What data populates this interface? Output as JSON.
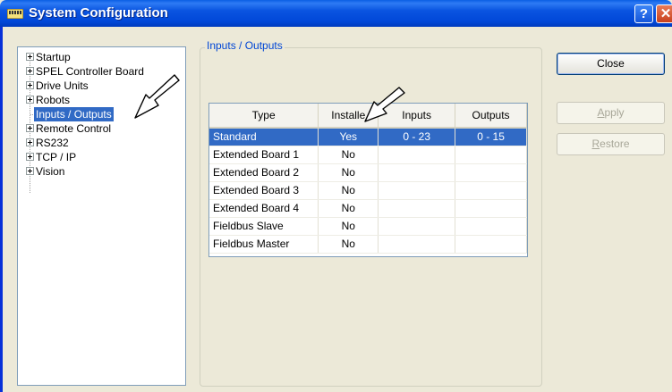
{
  "window": {
    "title": "System Configuration",
    "help_label": "?",
    "close_label": "✕"
  },
  "tree": {
    "items": [
      {
        "label": "Startup",
        "expandable": true
      },
      {
        "label": "SPEL Controller Board",
        "expandable": true
      },
      {
        "label": "Drive Units",
        "expandable": true
      },
      {
        "label": "Robots",
        "expandable": true
      },
      {
        "label": "Inputs / Outputs",
        "expandable": false,
        "selected": true
      },
      {
        "label": "Remote Control",
        "expandable": true
      },
      {
        "label": "RS232",
        "expandable": true
      },
      {
        "label": "TCP / IP",
        "expandable": true
      },
      {
        "label": "Vision",
        "expandable": true
      }
    ]
  },
  "group": {
    "title": "Inputs / Outputs"
  },
  "grid": {
    "columns": [
      "Type",
      "Installe",
      "Inputs",
      "Outputs"
    ],
    "rows": [
      {
        "type": "Standard",
        "installed": "Yes",
        "inputs": "0 - 23",
        "outputs": "0 - 15",
        "selected": true
      },
      {
        "type": "Extended Board 1",
        "installed": "No",
        "inputs": "",
        "outputs": ""
      },
      {
        "type": "Extended Board 2",
        "installed": "No",
        "inputs": "",
        "outputs": ""
      },
      {
        "type": "Extended Board 3",
        "installed": "No",
        "inputs": "",
        "outputs": ""
      },
      {
        "type": "Extended Board 4",
        "installed": "No",
        "inputs": "",
        "outputs": ""
      },
      {
        "type": "Fieldbus Slave",
        "installed": "No",
        "inputs": "",
        "outputs": ""
      },
      {
        "type": "Fieldbus Master",
        "installed": "No",
        "inputs": "",
        "outputs": ""
      }
    ]
  },
  "buttons": {
    "close": "Close",
    "apply": {
      "access_key": "A",
      "rest": "pply"
    },
    "restore": {
      "access_key": "R",
      "rest": "estore"
    }
  },
  "colors": {
    "titlebar": "#0A54E0",
    "selection": "#316AC5",
    "group_title": "#0046D5"
  }
}
